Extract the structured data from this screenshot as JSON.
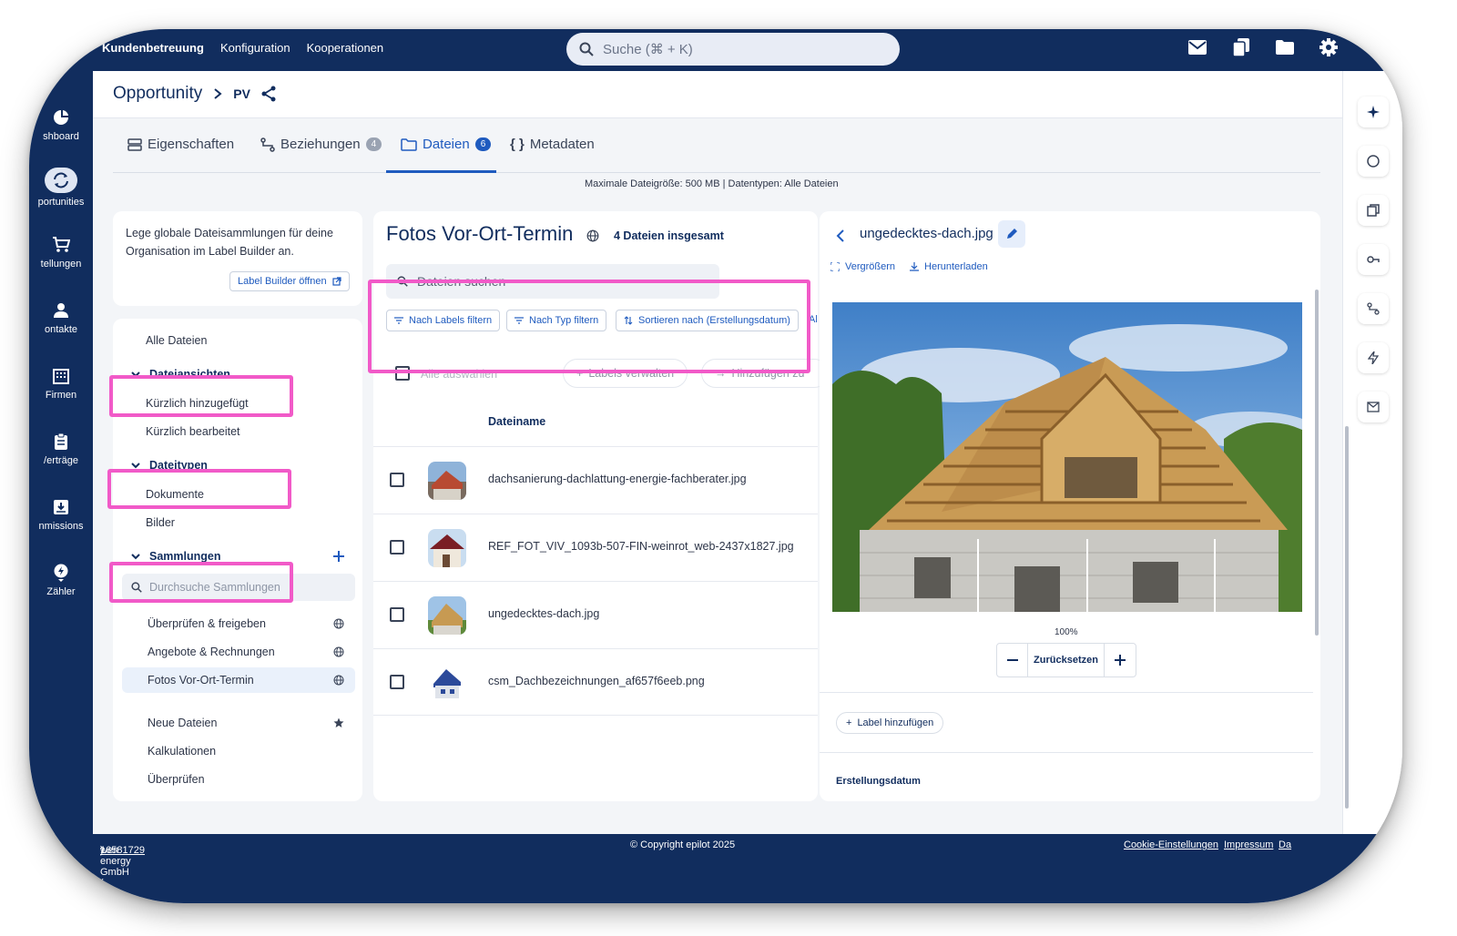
{
  "topbar": {
    "nav": [
      "Kundenbetreuung",
      "Konfiguration",
      "Kooperationen"
    ],
    "search_placeholder": "Suche (⌘ + K)",
    "icons": [
      "mail-icon",
      "copy-icon",
      "folder-icon",
      "gear-icon"
    ]
  },
  "sidebar": {
    "items": [
      {
        "label": "shboard",
        "icon": "dashboard-icon"
      },
      {
        "label": "portunities",
        "icon": "refresh-icon"
      },
      {
        "label": "tellungen",
        "icon": "cart-icon"
      },
      {
        "label": "ontakte",
        "icon": "person-icon"
      },
      {
        "label": "Firmen",
        "icon": "building-icon"
      },
      {
        "label": "/erträge",
        "icon": "clipboard-icon"
      },
      {
        "label": "nmissions",
        "icon": "inbox-icon"
      },
      {
        "label": "Zähler",
        "icon": "meter-icon"
      }
    ]
  },
  "header": {
    "title": "Opportunity",
    "sub": "PV"
  },
  "tabs": [
    {
      "label": "Eigenschaften",
      "badge": ""
    },
    {
      "label": "Beziehungen",
      "badge": "4"
    },
    {
      "label": "Dateien",
      "badge": "6"
    },
    {
      "label": "Metadaten",
      "badge": ""
    }
  ],
  "hint": "Maximale Dateigröße: 500 MB  |  Datentypen: Alle Dateien",
  "info_card": {
    "text": "Lege globale Dateisammlungen für deine Organisation im Label Builder an.",
    "button": "Label Builder öffnen"
  },
  "side_panel": {
    "all_files": "Alle Dateien",
    "sections": [
      {
        "title": "Dateiansichten",
        "items": [
          "Kürzlich hinzugefügt",
          "Kürzlich bearbeitet"
        ]
      },
      {
        "title": "Dateitypen",
        "items": [
          "Dokumente",
          "Bilder"
        ]
      },
      {
        "title": "Sammlungen",
        "items": []
      }
    ],
    "collections_search": "Durchsuche Sammlungen",
    "collections": [
      "Überprüfen & freigeben",
      "Angebote & Rechnungen",
      "Fotos Vor-Ort-Termin"
    ],
    "extra": [
      "Neue Dateien",
      "Kalkulationen",
      "Überprüfen"
    ]
  },
  "files_panel": {
    "title": "Fotos Vor-Ort-Termin",
    "count": "4 Dateien insgesamt",
    "search_placeholder": "Dateien suchen",
    "filters": [
      "Nach Labels filtern",
      "Nach Typ filtern",
      "Sortieren nach (Erstellungsdatum)"
    ],
    "filter_overflow": "Al",
    "select_all": "Alle auswählen",
    "manage_labels": "Labels verwalten",
    "add_to": "Hinzufügen zu",
    "column": "Dateiname",
    "files": [
      "dachsanierung-dachlattung-energie-fachberater.jpg",
      "REF_FOT_VIV_1093b-507-FIN-weinrot_web-2437x1827.jpg",
      "ungedecktes-dach.jpg",
      "csm_Dachbezeichnungen_af657f6eeb.png"
    ]
  },
  "preview": {
    "filename": "ungedecktes-dach.jpg",
    "enlarge": "Vergrößern",
    "download": "Herunterladen",
    "zoom": "100%",
    "reset": "Zurücksetzen",
    "add_label": "Label hinzufügen",
    "created": "Erstellungsdatum"
  },
  "footer": {
    "left": "wen energy GmbH (",
    "left_link": "16581729",
    "left_end": ")",
    "center": "© Copyright epilot 2025",
    "cookie": "Cookie-Einstellungen",
    "impressum": "Impressum",
    "more": "Da"
  },
  "colors": {
    "navy": "#112d5e",
    "accent": "#1f5bbf",
    "highlight": "#f15ac8"
  }
}
